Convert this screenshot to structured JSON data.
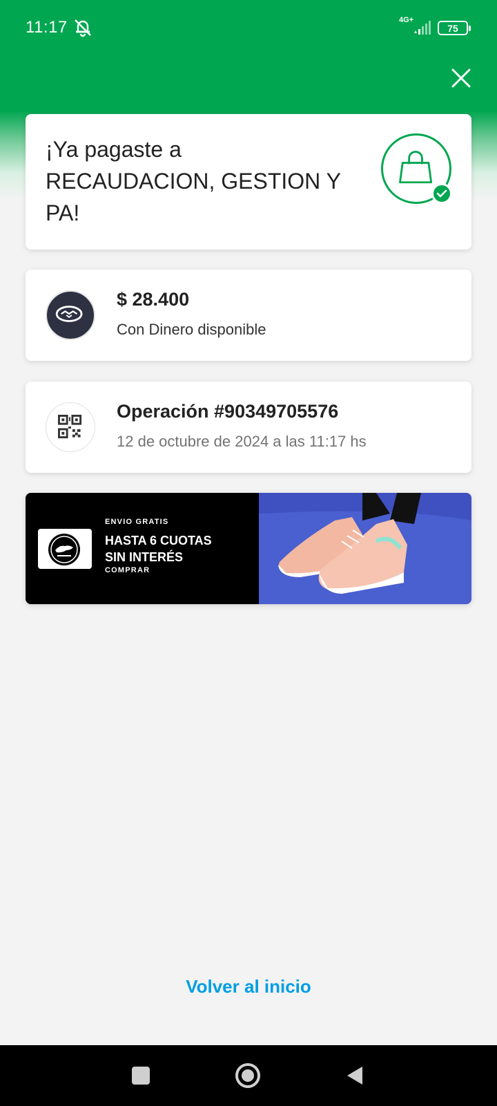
{
  "status": {
    "time": "11:17",
    "network": "4G+",
    "battery": "75",
    "icons": [
      "bell-off-icon",
      "signal-icon",
      "battery-icon"
    ]
  },
  "colors": {
    "brand_green": "#00a650",
    "link_blue": "#009ee3",
    "dark_icon_bg": "#2d3142"
  },
  "header": {
    "close_icon": "close-icon"
  },
  "success": {
    "title": "¡Ya pagaste a RECAUDACION, GESTION Y PA!",
    "icon": "shopping-bag-check-icon"
  },
  "payment": {
    "amount": "$ 28.400",
    "method": "Con Dinero disponible",
    "icon": "handshake-icon"
  },
  "operation": {
    "title": "Operación #90349705576",
    "datetime": "12 de octubre de 2024 a las 11:17 hs",
    "icon": "qr-code-icon"
  },
  "banner": {
    "tag": "ENVIO GRATIS",
    "headline_1": "HASTA 6 CUOTAS",
    "headline_2": "SIN INTERÉS",
    "cta": "COMPRAR",
    "logo": "jaguar-logo",
    "image": "sneakers-image"
  },
  "footer": {
    "back_label": "Volver al inicio"
  },
  "nav": {
    "icons": [
      "recents-icon",
      "home-icon",
      "back-icon"
    ]
  }
}
